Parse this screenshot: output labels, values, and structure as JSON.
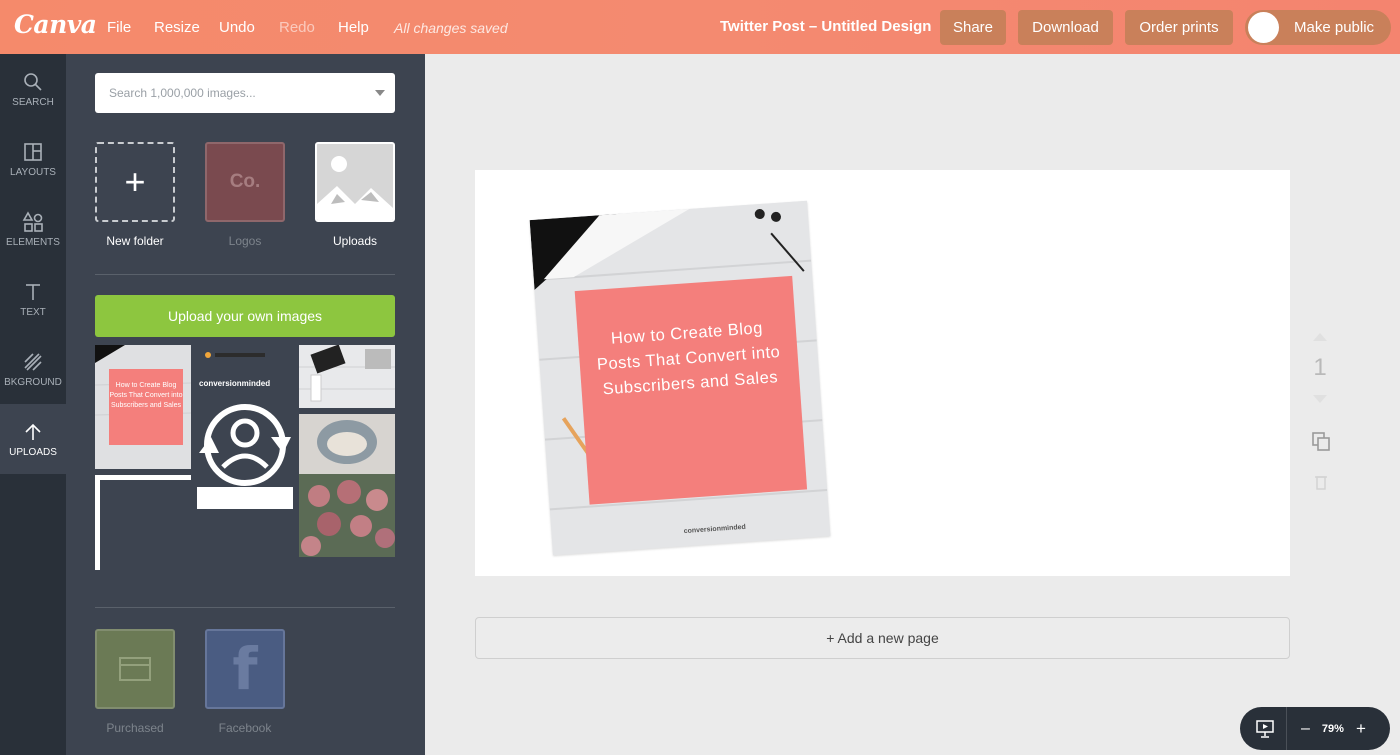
{
  "app": {
    "logo_text": "Canva"
  },
  "topbar": {
    "menu": [
      {
        "label": "File",
        "enabled": true
      },
      {
        "label": "Resize",
        "enabled": true
      },
      {
        "label": "Undo",
        "enabled": true
      },
      {
        "label": "Redo",
        "enabled": false
      },
      {
        "label": "Help",
        "enabled": true
      }
    ],
    "status": "All changes saved",
    "doc_title": "Twitter Post – Untitled Design",
    "share_label": "Share",
    "download_label": "Download",
    "order_label": "Order prints",
    "public_label": "Make public"
  },
  "rail": {
    "items": [
      {
        "label": "SEARCH",
        "icon": "search-icon"
      },
      {
        "label": "LAYOUTS",
        "icon": "layouts-icon"
      },
      {
        "label": "ELEMENTS",
        "icon": "elements-icon"
      },
      {
        "label": "TEXT",
        "icon": "text-icon"
      },
      {
        "label": "BKGROUND",
        "icon": "background-icon"
      },
      {
        "label": "UPLOADS",
        "icon": "upload-arrow-icon",
        "active": true
      }
    ]
  },
  "panel": {
    "search_placeholder": "Search 1,000,000 images...",
    "folders": {
      "new_folder": "New folder",
      "logos": "Logos",
      "logos_badge": "Co.",
      "uploads": "Uploads"
    },
    "upload_button": "Upload your own images",
    "bottom_folders": {
      "purchased": "Purchased",
      "facebook": "Facebook",
      "facebook_glyph": "f"
    }
  },
  "design": {
    "headline": "How to Create Blog Posts That Convert into Subscribers and Sales",
    "brand_text": "conversionminded",
    "accent_color": "#f47f7c"
  },
  "canvas": {
    "add_page": "+ Add a new page",
    "page_number": "1"
  },
  "zoom": {
    "level": "79%",
    "minus": "–",
    "plus": "+"
  },
  "colors": {
    "topbar": "#f48a6d",
    "rail": "#293039",
    "panel": "#3d4450",
    "upload_button": "#8dc63f"
  }
}
